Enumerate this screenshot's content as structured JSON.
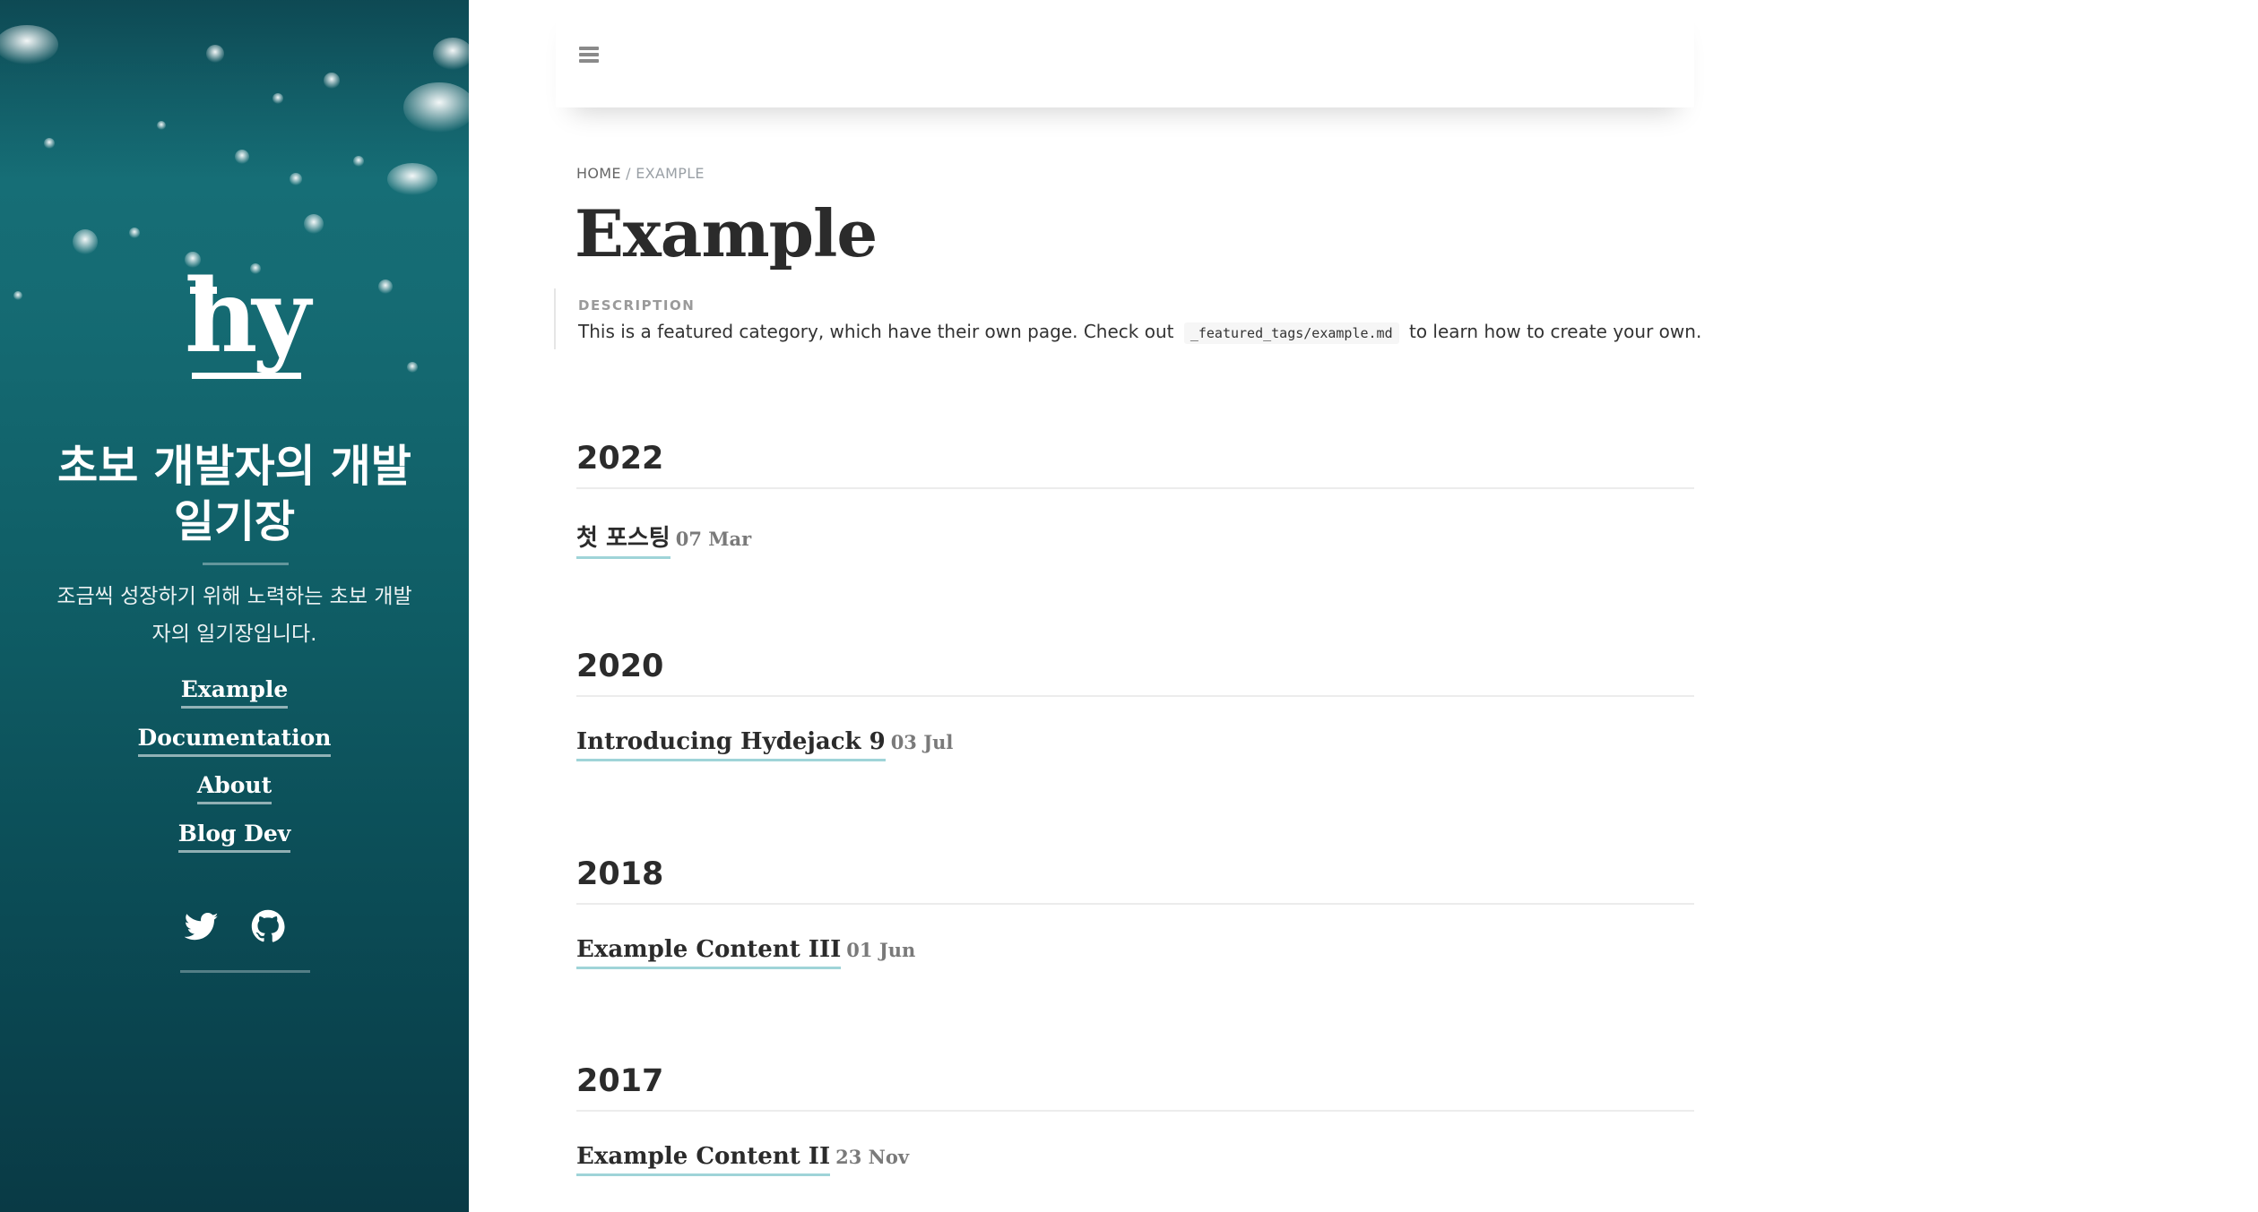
{
  "sidebar": {
    "logo_text": "hy",
    "title": "초보 개발자의 개발 일기장",
    "description": "조금씩 성장하기 위해 노력하는 초보 개발자의 일기장입니다.",
    "nav": [
      {
        "label": "Example"
      },
      {
        "label": "Documentation"
      },
      {
        "label": "About"
      },
      {
        "label": "Blog Dev"
      }
    ],
    "social": [
      {
        "icon": "twitter-icon"
      },
      {
        "icon": "github-icon"
      }
    ],
    "accent": "#156b73"
  },
  "topbar": {
    "menu_icon": "menu-icon"
  },
  "breadcrumb": {
    "home": "HOME",
    "separator": "/",
    "current": "EXAMPLE"
  },
  "page": {
    "title": "Example",
    "description_label": "DESCRIPTION",
    "description_before": "This is a featured category, which have their own page. Check out",
    "description_code": "_featured_tags/example.md",
    "description_after": "to learn how to create your own."
  },
  "years": [
    {
      "year": "2022",
      "posts": [
        {
          "title": "첫 포스팅",
          "date": "07 Mar"
        }
      ]
    },
    {
      "year": "2020",
      "posts": [
        {
          "title": "Introducing Hydejack 9",
          "date": "03 Jul"
        }
      ]
    },
    {
      "year": "2018",
      "posts": [
        {
          "title": "Example Content III",
          "date": "01 Jun"
        }
      ]
    },
    {
      "year": "2017",
      "posts": [
        {
          "title": "Example Content II",
          "date": "23 Nov"
        }
      ]
    }
  ]
}
